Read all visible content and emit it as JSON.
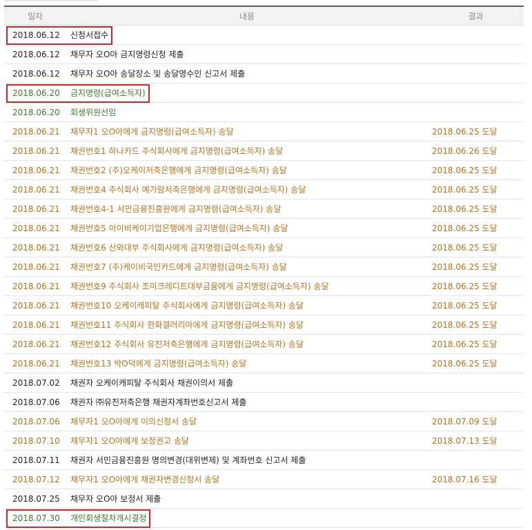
{
  "headers": {
    "date": "일자",
    "content": "내용",
    "result": "결과"
  },
  "colors": {
    "black": "#222222",
    "green": "#3f7a30",
    "orange": "#b8711a",
    "highlight": "#e02020"
  },
  "rows": [
    {
      "date": "2018.06.12",
      "content": "신청서접수",
      "result": "",
      "color": "black",
      "highlight": true
    },
    {
      "date": "2018.06.12",
      "content": "채무자 오O아 금지명령신청 제출",
      "result": "",
      "color": "black",
      "highlight": false
    },
    {
      "date": "2018.06.12",
      "content": "채무자 오O아 송달장소 및 송달영수인 신고서 제출",
      "result": "",
      "color": "black",
      "highlight": false
    },
    {
      "date": "2018.06.20",
      "content": "금지명령(급여소득자)",
      "result": "",
      "color": "green",
      "highlight": true
    },
    {
      "date": "2018.06.20",
      "content": "회생위원선임",
      "result": "",
      "color": "green",
      "highlight": false
    },
    {
      "date": "2018.06.21",
      "content": "채무자1 오O아에게 금지명령(급여소득자) 송달",
      "result": "2018.06.25 도달",
      "color": "orange",
      "highlight": false
    },
    {
      "date": "2018.06.21",
      "content": "채권번호1 하나카드 주식회사에게 금지명령(급여소득자) 송달",
      "result": "2018.06.26 도달",
      "color": "orange",
      "highlight": false
    },
    {
      "date": "2018.06.21",
      "content": "채권번호2 (주)오케이저축은행에게 금지명령(급여소득자) 송달",
      "result": "2018.06.25 도달",
      "color": "orange",
      "highlight": false
    },
    {
      "date": "2018.06.21",
      "content": "채권번호4 주식회사 예가람저축은행에게 금지명령(급여소득자) 송달",
      "result": "2018.06.25 도달",
      "color": "orange",
      "highlight": false
    },
    {
      "date": "2018.06.21",
      "content": "채권번호4-1 서민금융진흥원에게 금지명령(급여소득자) 송달",
      "result": "2018.06.25 도달",
      "color": "orange",
      "highlight": false
    },
    {
      "date": "2018.06.21",
      "content": "채권번호5 아이비케이기업은행에게 금지명령(급여소득자) 송달",
      "result": "2018.06.25 도달",
      "color": "orange",
      "highlight": false
    },
    {
      "date": "2018.06.21",
      "content": "채권번호6 산와대부 주식회사에게 금지명령(급여소득자) 송달",
      "result": "2018.06.25 도달",
      "color": "orange",
      "highlight": false
    },
    {
      "date": "2018.06.21",
      "content": "채권번호7 (주)케이비국민카드에게 금지명령(급여소득자) 송달",
      "result": "2018.06.25 도달",
      "color": "orange",
      "highlight": false
    },
    {
      "date": "2018.06.21",
      "content": "채권번호9 주식회사 조이크레디트대부금융에게 금지명령(급여소득자) 송달",
      "result": "2018.06.25 도달",
      "color": "orange",
      "highlight": false
    },
    {
      "date": "2018.06.21",
      "content": "채권번호10 오케이캐피탈 주식회사에게 금지명령(급여소득자) 송달",
      "result": "2018.06.25 도달",
      "color": "orange",
      "highlight": false
    },
    {
      "date": "2018.06.21",
      "content": "채권번호11 주식회사 한화갤러리아에게 금지명령(급여소득자) 송달",
      "result": "2018.06.25 도달",
      "color": "orange",
      "highlight": false
    },
    {
      "date": "2018.06.21",
      "content": "채권번호12 주식회사 유진저축은행에게 금지명령(급여소득자) 송달",
      "result": "2018.06.25 도달",
      "color": "orange",
      "highlight": false
    },
    {
      "date": "2018.06.21",
      "content": "채권번호13 박O덕에게 금지명령(급여소득자) 송달",
      "result": "2018.06.25 도달",
      "color": "orange",
      "highlight": false
    },
    {
      "date": "2018.07.02",
      "content": "채권자 오케이캐피탈 주식회사 채권이의서 제출",
      "result": "",
      "color": "black",
      "highlight": false
    },
    {
      "date": "2018.07.06",
      "content": "채권자 ㈜유진저축은행 채권자계좌번호신고서 제출",
      "result": "",
      "color": "black",
      "highlight": false
    },
    {
      "date": "2018.07.06",
      "content": "채무자1 오O아에게 이의신청서 송달",
      "result": "2018.07.09 도달",
      "color": "orange",
      "highlight": false
    },
    {
      "date": "2018.07.10",
      "content": "채무자1 오O아에게 보정권고 송달",
      "result": "2018.07.13 도달",
      "color": "orange",
      "highlight": false
    },
    {
      "date": "2018.07.11",
      "content": "채권자 서민금융진흥원 명의변경(대위변제) 및 계좌번호 신고서 제출",
      "result": "",
      "color": "black",
      "highlight": false
    },
    {
      "date": "2018.07.12",
      "content": "채무자1 오O아에게 채권자변경신청서 송달",
      "result": "2018.07.16 도달",
      "color": "orange",
      "highlight": false
    },
    {
      "date": "2018.07.25",
      "content": "채무자 오O아 보정서 제출",
      "result": "",
      "color": "black",
      "highlight": false
    },
    {
      "date": "2018.07.30",
      "content": "개인회생절차개시결정",
      "result": "",
      "color": "green",
      "highlight": true
    }
  ]
}
